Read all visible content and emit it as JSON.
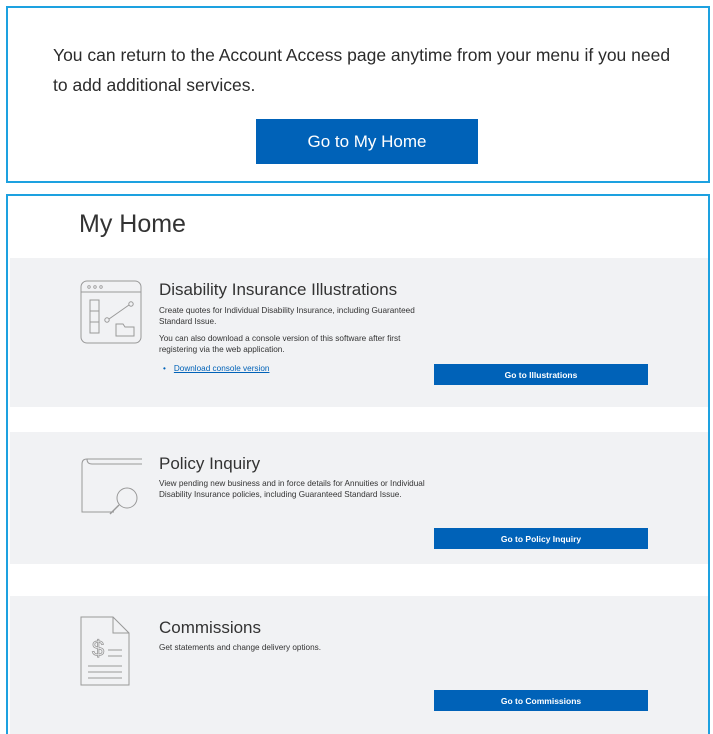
{
  "top_panel": {
    "message": "You can return to the Account Access page anytime from your menu if you need to add additional services.",
    "button_label": "Go to My Home"
  },
  "home": {
    "title": "My Home",
    "cards": [
      {
        "title": "Disability Insurance Illustrations",
        "description": "Create quotes for Individual Disability Insurance, including Guaranteed Standard Issue.",
        "extra": "You can also download a console version of this software after first registering via the web application.",
        "link_label": "Download console version",
        "button_label": "Go to Illustrations",
        "icon": "illustration-window-icon"
      },
      {
        "title": "Policy Inquiry",
        "description": "View pending new business and in force details for Annuities or Individual Disability Insurance policies, including Guaranteed Standard Issue.",
        "button_label": "Go to Policy Inquiry",
        "icon": "magnifier-book-icon"
      },
      {
        "title": "Commissions",
        "description": "Get statements and change delivery options.",
        "button_label": "Go to Commissions",
        "icon": "dollar-document-icon"
      }
    ]
  },
  "colors": {
    "accent": "#0062b8",
    "border": "#1da1e0",
    "card_bg": "#f1f2f4"
  }
}
